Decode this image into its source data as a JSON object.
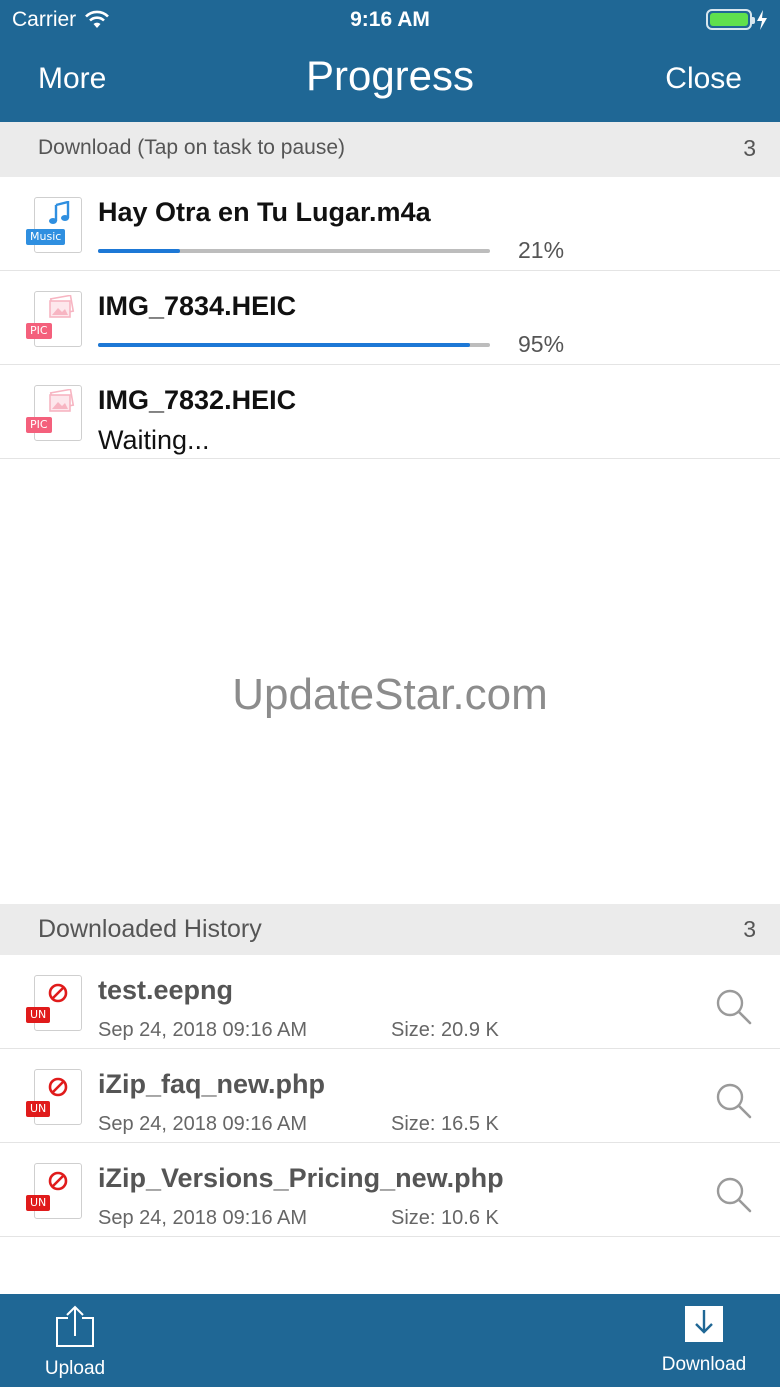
{
  "status_bar": {
    "carrier": "Carrier",
    "time": "9:16 AM"
  },
  "nav": {
    "left_button": "More",
    "title": "Progress",
    "right_button": "Close"
  },
  "download_section": {
    "header": "Download (Tap on task to pause)",
    "count": "3",
    "items": [
      {
        "name": "Hay Otra en Tu Lugar.m4a",
        "tag": "Music",
        "progress": 0.21,
        "progress_label": "21%"
      },
      {
        "name": "IMG_7834.HEIC",
        "tag": "PIC",
        "progress": 0.95,
        "progress_label": "95%"
      },
      {
        "name": "IMG_7832.HEIC",
        "tag": "PIC",
        "status": "Waiting..."
      }
    ]
  },
  "watermark": "UpdateStar.com",
  "history_section": {
    "header": "Downloaded History",
    "count": "3",
    "items": [
      {
        "name": "test.eepng",
        "tag": "UN",
        "date": "Sep 24, 2018 09:16 AM",
        "size": "Size: 20.9 K"
      },
      {
        "name": "iZip_faq_new.php",
        "tag": "UN",
        "date": "Sep 24, 2018 09:16 AM",
        "size": "Size: 16.5 K"
      },
      {
        "name": "iZip_Versions_Pricing_new.php",
        "tag": "UN",
        "date": "Sep 24, 2018 09:16 AM",
        "size": "Size: 10.6 K"
      }
    ]
  },
  "toolbar": {
    "upload_label": "Upload",
    "download_label": "Download"
  },
  "colors": {
    "bar": "#1f6795",
    "progress": "#1d78d6",
    "pic_tag": "#f4607c",
    "music_tag": "#2f8fe0",
    "un_tag": "#e01b1b"
  }
}
